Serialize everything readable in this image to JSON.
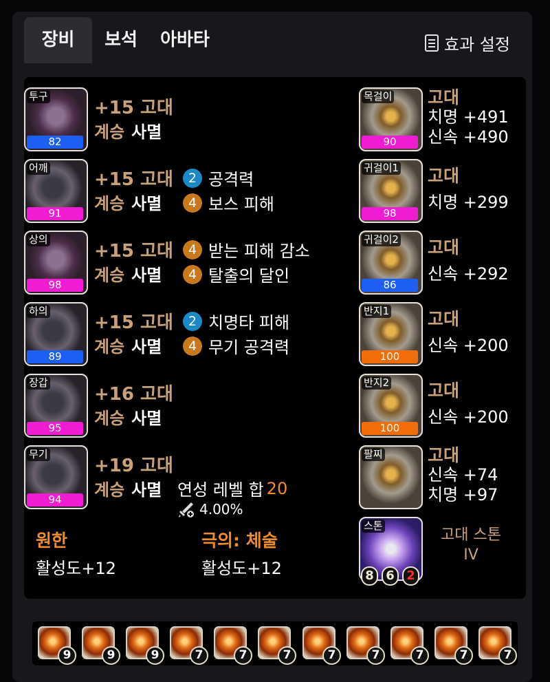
{
  "tabs": [
    {
      "label": "장비",
      "active": true
    },
    {
      "label": "보석"
    },
    {
      "label": "아바타"
    }
  ],
  "effect_settings": {
    "label": "효과 설정",
    "icon": "document-icon"
  },
  "equipment": [
    {
      "slot": "투구",
      "quality": 82,
      "color": "#1e5ef2",
      "level": "+15 고대",
      "set": "계승",
      "set_name": "사멸"
    },
    {
      "slot": "어깨",
      "quality": 91,
      "color": "#f01bd3",
      "level": "+15 고대",
      "set": "계승",
      "set_name": "사멸"
    },
    {
      "slot": "상의",
      "quality": 98,
      "color": "#f01bd3",
      "level": "+15 고대",
      "set": "계승",
      "set_name": "사멸"
    },
    {
      "slot": "하의",
      "quality": 89,
      "color": "#1e5ef2",
      "level": "+15 고대",
      "set": "계승",
      "set_name": "사멸"
    },
    {
      "slot": "장갑",
      "quality": 95,
      "color": "#f01bd3",
      "level": "+16 고대",
      "set": "계승",
      "set_name": "사멸"
    },
    {
      "slot": "무기",
      "quality": 94,
      "color": "#f01bd3",
      "level": "+19 고대",
      "set": "계승",
      "set_name": "사멸"
    }
  ],
  "effects": [
    {
      "num": "2",
      "color": "#1c88c8",
      "label": "공격력"
    },
    {
      "num": "4",
      "color": "#c8791c",
      "label": "보스 피해"
    },
    {
      "num": "4",
      "color": "#c8791c",
      "label": "받는 피해 감소"
    },
    {
      "num": "4",
      "color": "#c8791c",
      "label": "탈출의 달인"
    },
    {
      "num": "2",
      "color": "#1c88c8",
      "label": "치명타 피해"
    },
    {
      "num": "4",
      "color": "#c8791c",
      "label": "무기 공격력"
    }
  ],
  "elixir": {
    "label": "연성 레벨 합",
    "value": "20",
    "percent": "4.00%"
  },
  "engravings": [
    {
      "name": "원한",
      "value": "활성도+12"
    },
    {
      "name": "극의: 체술",
      "value": "활성도+12"
    }
  ],
  "accessories": [
    {
      "slot": "목걸이",
      "quality": 90,
      "color": "#f01bd3",
      "grade": "고대",
      "stats": [
        "치명 +491",
        "신속 +490"
      ]
    },
    {
      "slot": "귀걸이1",
      "quality": 98,
      "color": "#f01bd3",
      "grade": "고대",
      "stats": [
        "치명 +299"
      ]
    },
    {
      "slot": "귀걸이2",
      "quality": 86,
      "color": "#1e5ef2",
      "grade": "고대",
      "stats": [
        "신속 +292"
      ]
    },
    {
      "slot": "반지1",
      "quality": 100,
      "color": "#f06d0a",
      "grade": "고대",
      "stats": [
        "신속 +200"
      ]
    },
    {
      "slot": "반지2",
      "quality": 100,
      "color": "#f06d0a",
      "grade": "고대",
      "stats": [
        "신속 +200"
      ]
    },
    {
      "slot": "팔찌",
      "grade": "고대",
      "stats": [
        "신속 +74",
        "치명 +97"
      ]
    }
  ],
  "stone": {
    "slot": "스톤",
    "label": "고대 스톤 IV",
    "nums": [
      "8",
      "6",
      "2"
    ],
    "num_colors": [
      "#f2ead2",
      "#f2ead2",
      "#ff2a2a"
    ]
  },
  "gems": [
    "9",
    "9",
    "9",
    "7",
    "7",
    "7",
    "7",
    "7",
    "7",
    "7",
    "7"
  ]
}
